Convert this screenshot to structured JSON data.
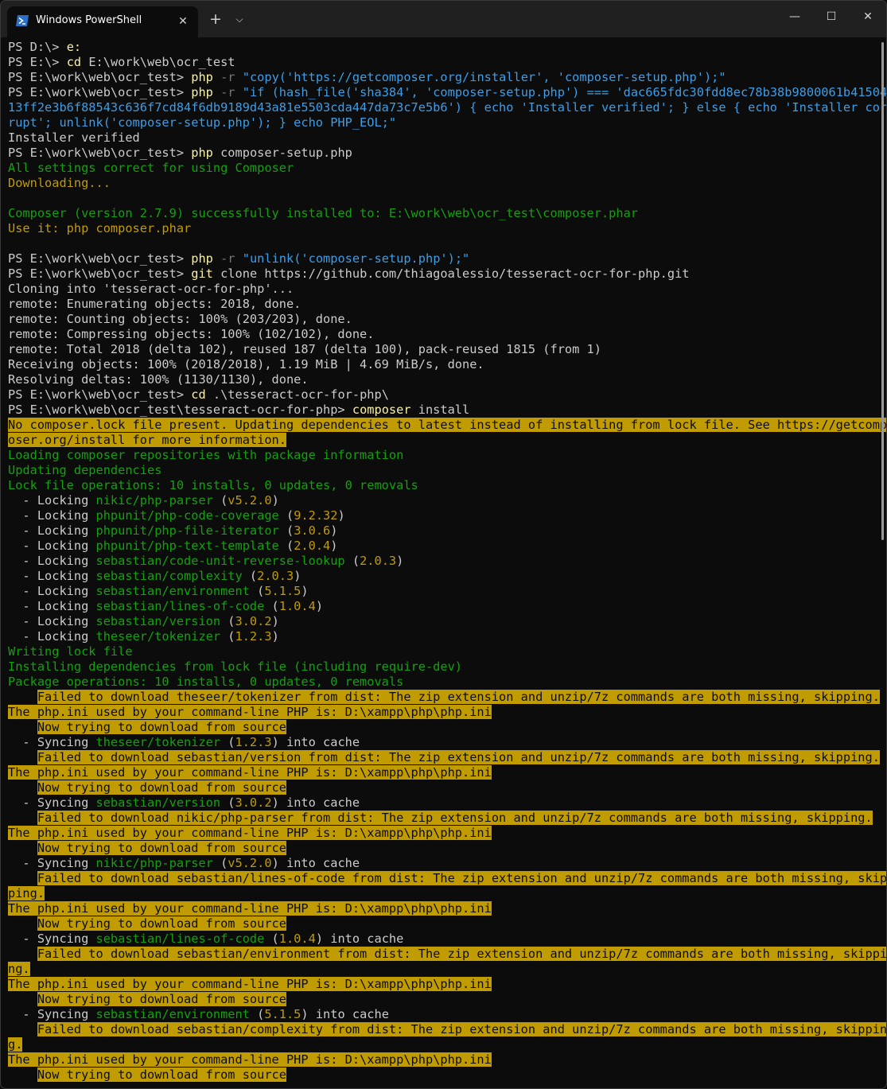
{
  "window": {
    "tab_title": "Windows PowerShell",
    "tab_close": "✕",
    "new_tab": "+",
    "dropdown": "⌵",
    "minimize": "—",
    "maximize": "☐",
    "close": "✕"
  },
  "colors": {
    "background": "#0c0c0c",
    "command_yellow": "#f9f1a5",
    "string_blue": "#3b9ee8",
    "success_green": "#13a10e",
    "warning_bg": "#c19c00"
  },
  "terminal": {
    "lines": [
      [
        [
          "PS D:\\> ",
          ""
        ],
        [
          "e:",
          "y"
        ]
      ],
      [
        [
          "PS E:\\> ",
          ""
        ],
        [
          "cd",
          "y"
        ],
        [
          " E:\\work\\web\\ocr_test",
          ""
        ]
      ],
      [
        [
          "PS E:\\work\\web\\ocr_test> ",
          ""
        ],
        [
          "php",
          "y"
        ],
        [
          " -r",
          "g"
        ],
        [
          " \"copy('https://getcomposer.org/installer', 'composer-setup.php');\"",
          "b"
        ]
      ],
      [
        [
          "PS E:\\work\\web\\ocr_test> ",
          ""
        ],
        [
          "php",
          "y"
        ],
        [
          " -r",
          "g"
        ],
        [
          " \"if (hash_file('sha384', 'composer-setup.php') === 'dac665fdc30fdd8ec78b38b9800061b41504",
          "b"
        ]
      ],
      [
        [
          "13ff2e3b6f88543c636f7cd84f6db9189d43a81e5503cda447da73c7e5b6') { echo 'Installer verified'; } else { echo 'Installer cor",
          "b"
        ]
      ],
      [
        [
          "rupt'; unlink('composer-setup.php'); } echo PHP_EOL;\"",
          "b"
        ]
      ],
      [
        [
          "Installer verified",
          ""
        ]
      ],
      [
        [
          "PS E:\\work\\web\\ocr_test> ",
          ""
        ],
        [
          "php",
          "y"
        ],
        [
          " composer-setup.php",
          ""
        ]
      ],
      [
        [
          "All settings correct for using Composer",
          "gr"
        ]
      ],
      [
        [
          "Downloading...",
          "k"
        ]
      ],
      [],
      [
        [
          "Composer (version 2.7.9) successfully installed to: E:\\work\\web\\ocr_test\\composer.phar",
          "gr"
        ]
      ],
      [
        [
          "Use it: php composer.phar",
          "k"
        ]
      ],
      [],
      [
        [
          "PS E:\\work\\web\\ocr_test> ",
          ""
        ],
        [
          "php",
          "y"
        ],
        [
          " -r",
          "g"
        ],
        [
          " \"unlink('composer-setup.php');\"",
          "b"
        ]
      ],
      [
        [
          "PS E:\\work\\web\\ocr_test> ",
          ""
        ],
        [
          "git",
          "y"
        ],
        [
          " clone https://github.com/thiagoalessio/tesseract-ocr-for-php.git",
          ""
        ]
      ],
      [
        [
          "Cloning into 'tesseract-ocr-for-php'...",
          ""
        ]
      ],
      [
        [
          "remote: Enumerating objects: 2018, done.",
          ""
        ]
      ],
      [
        [
          "remote: Counting objects: 100% (203/203), done.",
          ""
        ]
      ],
      [
        [
          "remote: Compressing objects: 100% (102/102), done.",
          ""
        ]
      ],
      [
        [
          "remote: Total 2018 (delta 102), reused 187 (delta 100), pack-reused 1815 (from 1)",
          ""
        ]
      ],
      [
        [
          "Receiving objects: 100% (2018/2018), 1.19 MiB | 4.69 MiB/s, done.",
          ""
        ]
      ],
      [
        [
          "Resolving deltas: 100% (1130/1130), done.",
          ""
        ]
      ],
      [
        [
          "PS E:\\work\\web\\ocr_test> ",
          ""
        ],
        [
          "cd",
          "y"
        ],
        [
          " .\\tesseract-ocr-for-php\\",
          ""
        ]
      ],
      [
        [
          "PS E:\\work\\web\\ocr_test\\tesseract-ocr-for-php> ",
          ""
        ],
        [
          "composer",
          "y"
        ],
        [
          " install",
          ""
        ]
      ],
      [
        [
          "No composer.lock file present. Updating dependencies to latest instead of installing from lock file. See https://getcomp",
          "bg"
        ]
      ],
      [
        [
          "oser.org/install for more information.",
          "bg"
        ]
      ],
      [
        [
          "Loading composer repositories with package information",
          "gr"
        ]
      ],
      [
        [
          "Updating dependencies",
          "gr"
        ]
      ],
      [
        [
          "Lock file operations: 10 installs, 0 updates, 0 removals",
          "gr"
        ]
      ],
      [
        [
          "  - Locking ",
          ""
        ],
        [
          "nikic/php-parser",
          "gr"
        ],
        [
          " (",
          ""
        ],
        [
          "v5.2.0",
          "k"
        ],
        [
          ")",
          ""
        ]
      ],
      [
        [
          "  - Locking ",
          ""
        ],
        [
          "phpunit/php-code-coverage",
          "gr"
        ],
        [
          " (",
          ""
        ],
        [
          "9.2.32",
          "k"
        ],
        [
          ")",
          ""
        ]
      ],
      [
        [
          "  - Locking ",
          ""
        ],
        [
          "phpunit/php-file-iterator",
          "gr"
        ],
        [
          " (",
          ""
        ],
        [
          "3.0.6",
          "k"
        ],
        [
          ")",
          ""
        ]
      ],
      [
        [
          "  - Locking ",
          ""
        ],
        [
          "phpunit/php-text-template",
          "gr"
        ],
        [
          " (",
          ""
        ],
        [
          "2.0.4",
          "k"
        ],
        [
          ")",
          ""
        ]
      ],
      [
        [
          "  - Locking ",
          ""
        ],
        [
          "sebastian/code-unit-reverse-lookup",
          "gr"
        ],
        [
          " (",
          ""
        ],
        [
          "2.0.3",
          "k"
        ],
        [
          ")",
          ""
        ]
      ],
      [
        [
          "  - Locking ",
          ""
        ],
        [
          "sebastian/complexity",
          "gr"
        ],
        [
          " (",
          ""
        ],
        [
          "2.0.3",
          "k"
        ],
        [
          ")",
          ""
        ]
      ],
      [
        [
          "  - Locking ",
          ""
        ],
        [
          "sebastian/environment",
          "gr"
        ],
        [
          " (",
          ""
        ],
        [
          "5.1.5",
          "k"
        ],
        [
          ")",
          ""
        ]
      ],
      [
        [
          "  - Locking ",
          ""
        ],
        [
          "sebastian/lines-of-code",
          "gr"
        ],
        [
          " (",
          ""
        ],
        [
          "1.0.4",
          "k"
        ],
        [
          ")",
          ""
        ]
      ],
      [
        [
          "  - Locking ",
          ""
        ],
        [
          "sebastian/version",
          "gr"
        ],
        [
          " (",
          ""
        ],
        [
          "3.0.2",
          "k"
        ],
        [
          ")",
          ""
        ]
      ],
      [
        [
          "  - Locking ",
          ""
        ],
        [
          "theseer/tokenizer",
          "gr"
        ],
        [
          " (",
          ""
        ],
        [
          "1.2.3",
          "k"
        ],
        [
          ")",
          ""
        ]
      ],
      [
        [
          "Writing lock file",
          "gr"
        ]
      ],
      [
        [
          "Installing dependencies from lock file (including require-dev)",
          "gr"
        ]
      ],
      [
        [
          "Package operations: 10 installs, 0 updates, 0 removals",
          "gr"
        ]
      ],
      [
        [
          "    ",
          ""
        ],
        [
          "Failed to download theseer/tokenizer from dist: The zip extension and unzip/7z commands are both missing, skipping.",
          "bg"
        ]
      ],
      [
        [
          "The php.ini used by your command-line PHP is: D:\\xampp\\php\\php.ini",
          "bg"
        ]
      ],
      [
        [
          "    ",
          ""
        ],
        [
          "Now trying to download from source",
          "bg"
        ]
      ],
      [
        [
          "  - Syncing ",
          ""
        ],
        [
          "theseer/tokenizer",
          "gr"
        ],
        [
          " (",
          ""
        ],
        [
          "1.2.3",
          "k"
        ],
        [
          ") into cache",
          ""
        ]
      ],
      [
        [
          "    ",
          ""
        ],
        [
          "Failed to download sebastian/version from dist: The zip extension and unzip/7z commands are both missing, skipping.",
          "bg"
        ]
      ],
      [
        [
          "The php.ini used by your command-line PHP is: D:\\xampp\\php\\php.ini",
          "bg"
        ]
      ],
      [
        [
          "    ",
          ""
        ],
        [
          "Now trying to download from source",
          "bg"
        ]
      ],
      [
        [
          "  - Syncing ",
          ""
        ],
        [
          "sebastian/version",
          "gr"
        ],
        [
          " (",
          ""
        ],
        [
          "3.0.2",
          "k"
        ],
        [
          ") into cache",
          ""
        ]
      ],
      [
        [
          "    ",
          ""
        ],
        [
          "Failed to download nikic/php-parser from dist: The zip extension and unzip/7z commands are both missing, skipping.",
          "bg"
        ]
      ],
      [
        [
          "The php.ini used by your command-line PHP is: D:\\xampp\\php\\php.ini",
          "bg"
        ]
      ],
      [
        [
          "    ",
          ""
        ],
        [
          "Now trying to download from source",
          "bg"
        ]
      ],
      [
        [
          "  - Syncing ",
          ""
        ],
        [
          "nikic/php-parser",
          "gr"
        ],
        [
          " (",
          ""
        ],
        [
          "v5.2.0",
          "k"
        ],
        [
          ") into cache",
          ""
        ]
      ],
      [
        [
          "    ",
          ""
        ],
        [
          "Failed to download sebastian/lines-of-code from dist: The zip extension and unzip/7z commands are both missing, skip",
          "bg"
        ]
      ],
      [
        [
          "ping.",
          "bg"
        ]
      ],
      [
        [
          "The php.ini used by your command-line PHP is: D:\\xampp\\php\\php.ini",
          "bg"
        ]
      ],
      [
        [
          "    ",
          ""
        ],
        [
          "Now trying to download from source",
          "bg"
        ]
      ],
      [
        [
          "  - Syncing ",
          ""
        ],
        [
          "sebastian/lines-of-code",
          "gr"
        ],
        [
          " (",
          ""
        ],
        [
          "1.0.4",
          "k"
        ],
        [
          ") into cache",
          ""
        ]
      ],
      [
        [
          "    ",
          ""
        ],
        [
          "Failed to download sebastian/environment from dist: The zip extension and unzip/7z commands are both missing, skippi",
          "bg"
        ]
      ],
      [
        [
          "ng.",
          "bg"
        ]
      ],
      [
        [
          "The php.ini used by your command-line PHP is: D:\\xampp\\php\\php.ini",
          "bg"
        ]
      ],
      [
        [
          "    ",
          ""
        ],
        [
          "Now trying to download from source",
          "bg"
        ]
      ],
      [
        [
          "  - Syncing ",
          ""
        ],
        [
          "sebastian/environment",
          "gr"
        ],
        [
          " (",
          ""
        ],
        [
          "5.1.5",
          "k"
        ],
        [
          ") into cache",
          ""
        ]
      ],
      [
        [
          "    ",
          ""
        ],
        [
          "Failed to download sebastian/complexity from dist: The zip extension and unzip/7z commands are both missing, skippin",
          "bg"
        ]
      ],
      [
        [
          "g.",
          "bg"
        ]
      ],
      [
        [
          "The php.ini used by your command-line PHP is: D:\\xampp\\php\\php.ini",
          "bg"
        ]
      ],
      [
        [
          "    ",
          ""
        ],
        [
          "Now trying to download from source",
          "bg"
        ]
      ]
    ]
  }
}
